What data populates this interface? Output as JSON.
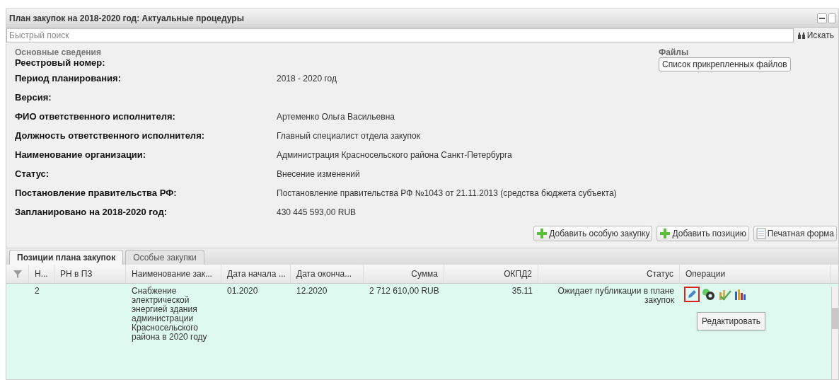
{
  "window": {
    "title": "План закупок на 2018-2020 год: Актуальные процедуры"
  },
  "search": {
    "placeholder": "Быстрый поиск",
    "button": "Искать"
  },
  "info": {
    "section": "Основные сведения",
    "fields": [
      {
        "label": "Реестровый номер:"
      },
      {
        "label": "Период планирования:",
        "value": "2018 - 2020 год"
      },
      {
        "label": "Версия:"
      },
      {
        "label": "ФИО ответственного исполнителя:",
        "value": "Артеменко Ольга Васильевна"
      },
      {
        "label": "Должность ответственного исполнителя:",
        "value": "Главный специалист отдела закупок"
      },
      {
        "label": "Наименование организации:",
        "value": "Администрация Красносельского района Санкт-Петербурга"
      },
      {
        "label": "Статус:",
        "value": "Внесение изменений"
      },
      {
        "label": "Постановление правительства РФ:",
        "value": "Постановление правительства РФ №1043 от 21.11.2013 (средства бюджета субъекта)"
      },
      {
        "label": "Запланировано на 2018-2020 год:",
        "value": "430 445 593,00 RUB"
      }
    ]
  },
  "files": {
    "title": "Файлы",
    "button": "Список прикрепленных файлов"
  },
  "actions": [
    {
      "kind": "add",
      "label": "Добавить особую закупку"
    },
    {
      "kind": "add",
      "label": "Добавить позицию"
    },
    {
      "kind": "print",
      "label": "Печатная форма"
    }
  ],
  "tabs": [
    {
      "label": "Позиции плана закупок",
      "selected": true
    },
    {
      "label": "Особые закупки",
      "selected": false
    }
  ],
  "table": {
    "columns": [
      "Н...",
      "РН в ПЗ",
      "Наименование зак...",
      "Дата начала ...",
      "Дата оконча...",
      "Сумма",
      "ОКПД2",
      "Статус",
      "Операции"
    ],
    "rows": [
      {
        "selected": true,
        "cells": [
          "2",
          "",
          "Снабжение электрической энергией здания администрации Красносельского района в 2020 году",
          "01.2020",
          "12.2020",
          "2 712 610,00 RUB",
          "35.11",
          "Ожидает публикации в плане закупок"
        ]
      }
    ]
  },
  "tooltip": "Редактировать"
}
